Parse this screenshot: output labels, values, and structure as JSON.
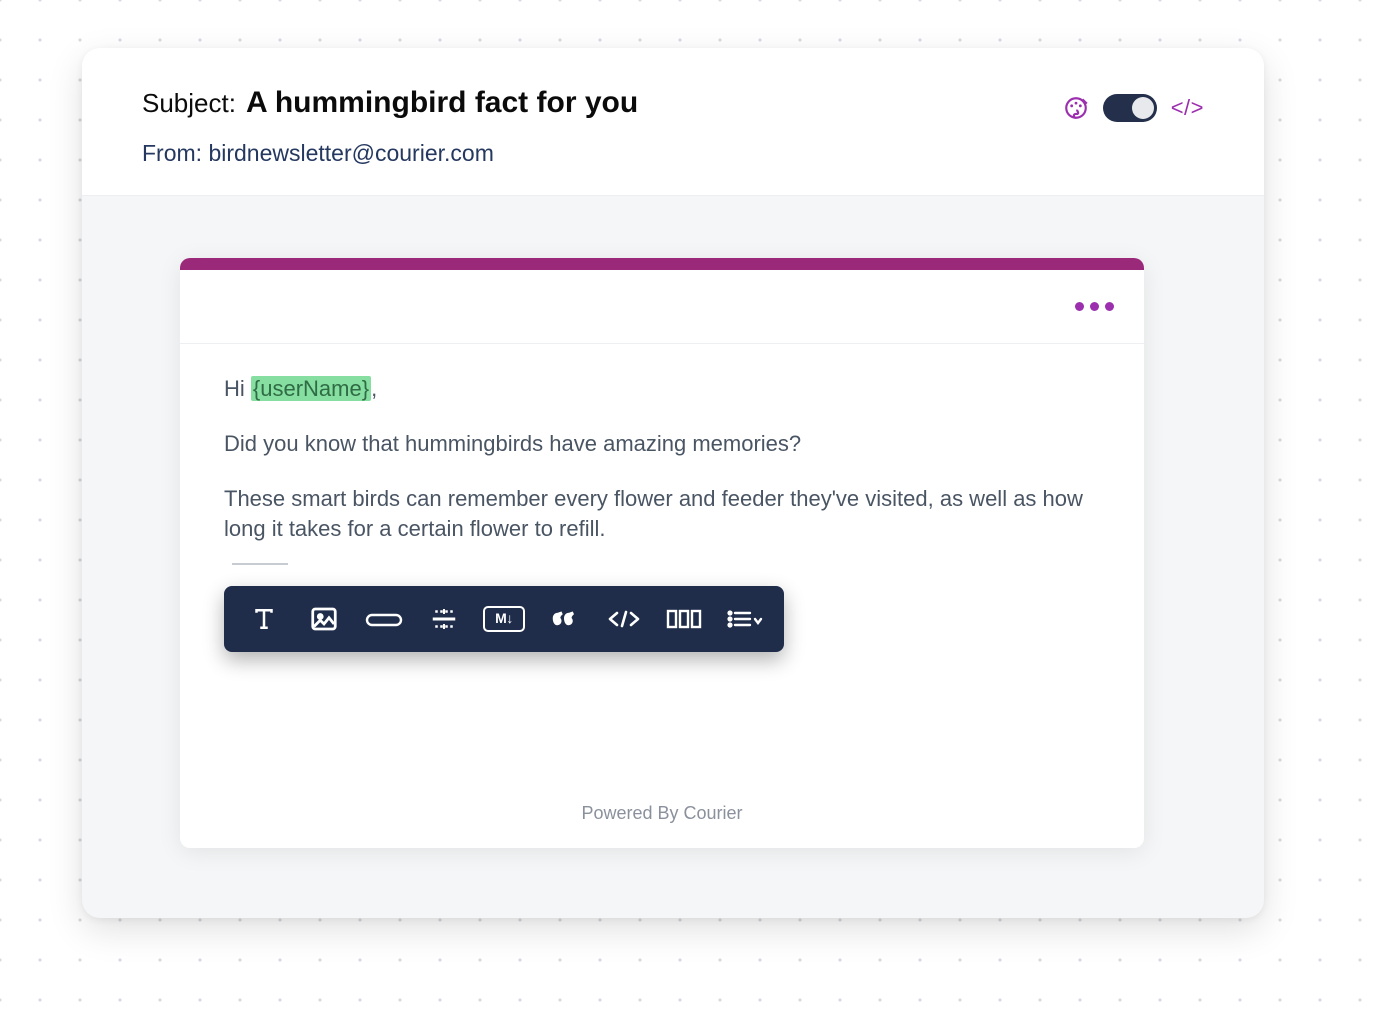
{
  "header": {
    "subject_label": "Subject:",
    "subject_value": "A hummingbird fact for you",
    "from_label": "From:",
    "from_value": "birdnewsletter@courier.com",
    "code_toggle_label": "</>"
  },
  "email": {
    "greeting_prefix": "Hi ",
    "variable_token": "{userName}",
    "greeting_suffix": ",",
    "para1": "Did you know that hummingbirds have amazing memories?",
    "para2": "These smart birds can remember every flower and feeder they've visited, as well as how long it takes for a certain flower to refill."
  },
  "toolbar": {
    "icons": {
      "text": "text-icon",
      "image": "image-icon",
      "button": "button-icon",
      "divider": "divider-icon",
      "markdown": "markdown-icon",
      "markdown_label": "M↓",
      "quote": "quote-icon",
      "code": "code-icon",
      "columns": "columns-icon",
      "list": "list-icon"
    }
  },
  "footer": {
    "text": "Powered By Courier"
  },
  "colors": {
    "accent_purple": "#9b2fae",
    "brand_magenta": "#9b2979",
    "toolbar_bg": "#1f2d4a",
    "var_highlight": "#86dfa1"
  }
}
